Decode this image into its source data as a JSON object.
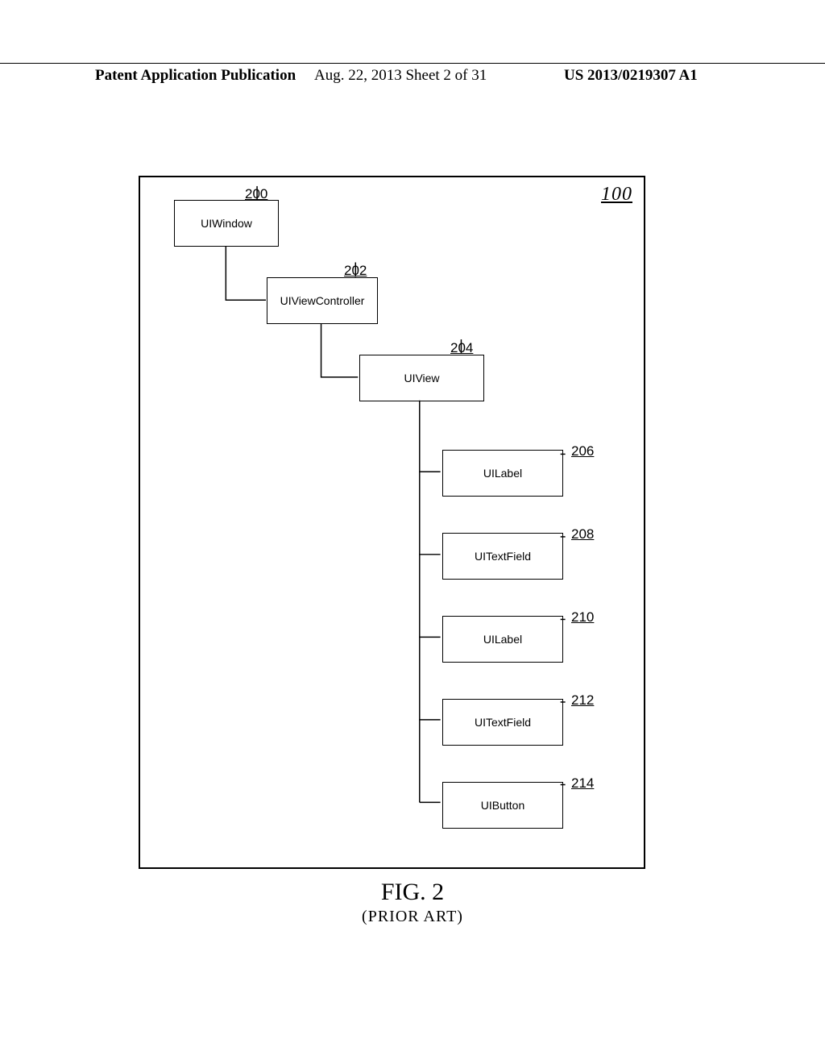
{
  "header": {
    "left": "Patent Application Publication",
    "center": "Aug. 22, 2013  Sheet 2 of 31",
    "right": "US 2013/0219307 A1"
  },
  "frame_ref": "100",
  "nodes": {
    "n0": {
      "label": "UIWindow",
      "ref": "200"
    },
    "n1": {
      "label": "UIViewController",
      "ref": "202"
    },
    "n2": {
      "label": "UIView",
      "ref": "204"
    },
    "n3": {
      "label": "UILabel",
      "ref": "206"
    },
    "n4": {
      "label": "UITextField",
      "ref": "208"
    },
    "n5": {
      "label": "UILabel",
      "ref": "210"
    },
    "n6": {
      "label": "UITextField",
      "ref": "212"
    },
    "n7": {
      "label": "UIButton",
      "ref": "214"
    }
  },
  "figure": {
    "main": "FIG. 2",
    "sub": "(PRIOR ART)"
  }
}
